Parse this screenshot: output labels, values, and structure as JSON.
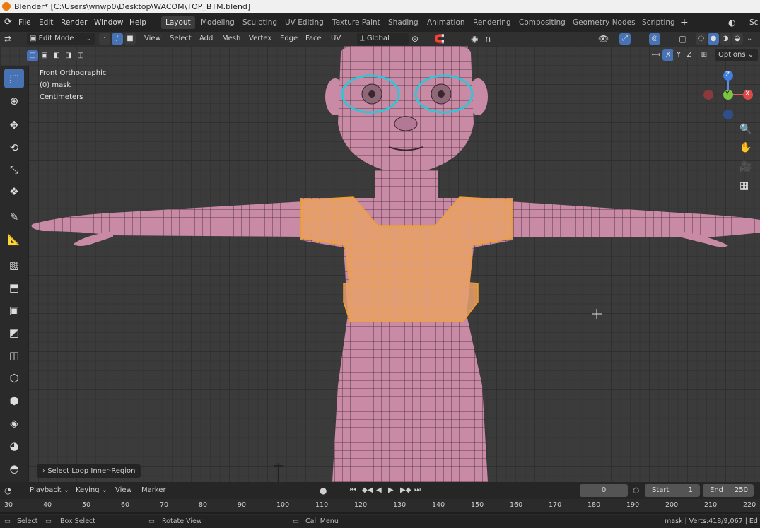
{
  "window": {
    "title": "Blender* [C:\\Users\\wnwp0\\Desktop\\WACOM\\TOP_BTM.blend]"
  },
  "menu": [
    "File",
    "Edit",
    "Render",
    "Window",
    "Help"
  ],
  "workspaces": [
    "Layout",
    "Modeling",
    "Sculpting",
    "UV Editing",
    "Texture Paint",
    "Shading",
    "Animation",
    "Rendering",
    "Compositing",
    "Geometry Nodes",
    "Scripting"
  ],
  "topbar_right": "Sc",
  "header": {
    "mode": "Edit Mode",
    "menus": [
      "View",
      "Select",
      "Add",
      "Mesh",
      "Vertex",
      "Edge",
      "Face",
      "UV"
    ],
    "transform_orientation": "Global",
    "axes": [
      "X",
      "Y",
      "Z"
    ],
    "options": "Options"
  },
  "viewport": {
    "view_name": "Front Orthographic",
    "object": "(0) mask",
    "units": "Centimeters",
    "last_op": "Select Loop Inner-Region",
    "colors": {
      "selected": "#f0a030",
      "highlight_loop": "#2ec6d8",
      "mesh": "#c98aa5"
    },
    "gizmo": {
      "z": "Z",
      "y": "Y",
      "x": "X"
    }
  },
  "timeline": {
    "menus": [
      "Playback",
      "Keying",
      "View",
      "Marker"
    ],
    "current_frame": "0",
    "start_label": "Start",
    "start": "1",
    "end_label": "End",
    "end": "250",
    "ruler": [
      "30",
      "40",
      "50",
      "60",
      "70",
      "80",
      "90",
      "100",
      "110",
      "120",
      "130",
      "140",
      "150",
      "160",
      "170",
      "180",
      "190",
      "200",
      "210",
      "220"
    ]
  },
  "status": {
    "select": "Select",
    "box_select": "Box Select",
    "rotate_view": "Rotate View",
    "call_menu": "Call Menu",
    "stats": "mask | Verts:418/9,067 | Ed"
  }
}
